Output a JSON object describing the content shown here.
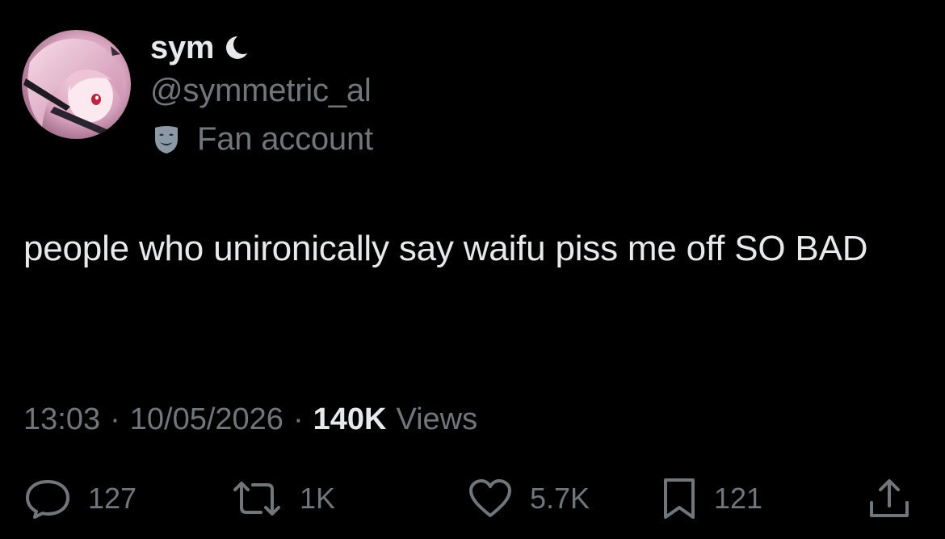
{
  "user": {
    "display_name": "sym",
    "status_icon": "crescent-moon-icon",
    "handle": "@symmetric_al",
    "label_icon": "theater-mask-icon",
    "label": "Fan account"
  },
  "tweet": {
    "text": "people who unironically say waifu piss me off SO BAD"
  },
  "meta": {
    "time": "13:03",
    "date": "10/05/2026",
    "separator": "·",
    "views_count": "140K",
    "views_label": "Views"
  },
  "actions": {
    "replies": "127",
    "reposts": "1K",
    "likes": "5.7K",
    "bookmarks": "121"
  },
  "colors": {
    "background": "#000000",
    "primary_text": "#e7e9ea",
    "secondary_text": "#71767b"
  }
}
